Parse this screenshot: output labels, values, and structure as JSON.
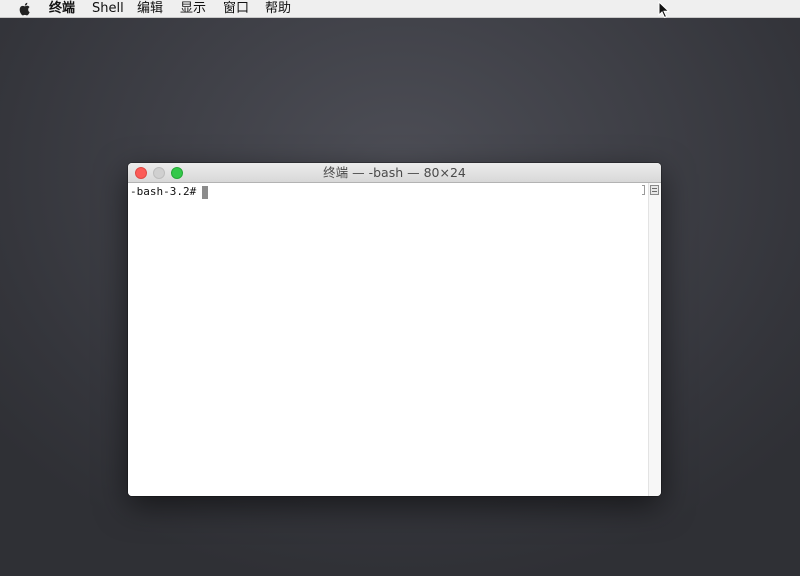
{
  "menubar": {
    "apple_icon": "apple-logo-icon",
    "items": [
      {
        "label": "终端",
        "bold": true
      },
      {
        "label": "Shell"
      },
      {
        "label": "编辑"
      },
      {
        "label": "显示"
      },
      {
        "label": "窗口"
      },
      {
        "label": "帮助"
      }
    ]
  },
  "window": {
    "title": "终端 — -bash — 80×24",
    "buttons": {
      "close": "close-button",
      "minimize": "minimize-button",
      "zoom": "zoom-button"
    },
    "terminal": {
      "prompt": "-bash-3.2#"
    }
  },
  "colors": {
    "close": "#fc5b57",
    "minimize": "#d0d0d0",
    "zoom": "#34c84a",
    "desktop": "#3f4047"
  }
}
